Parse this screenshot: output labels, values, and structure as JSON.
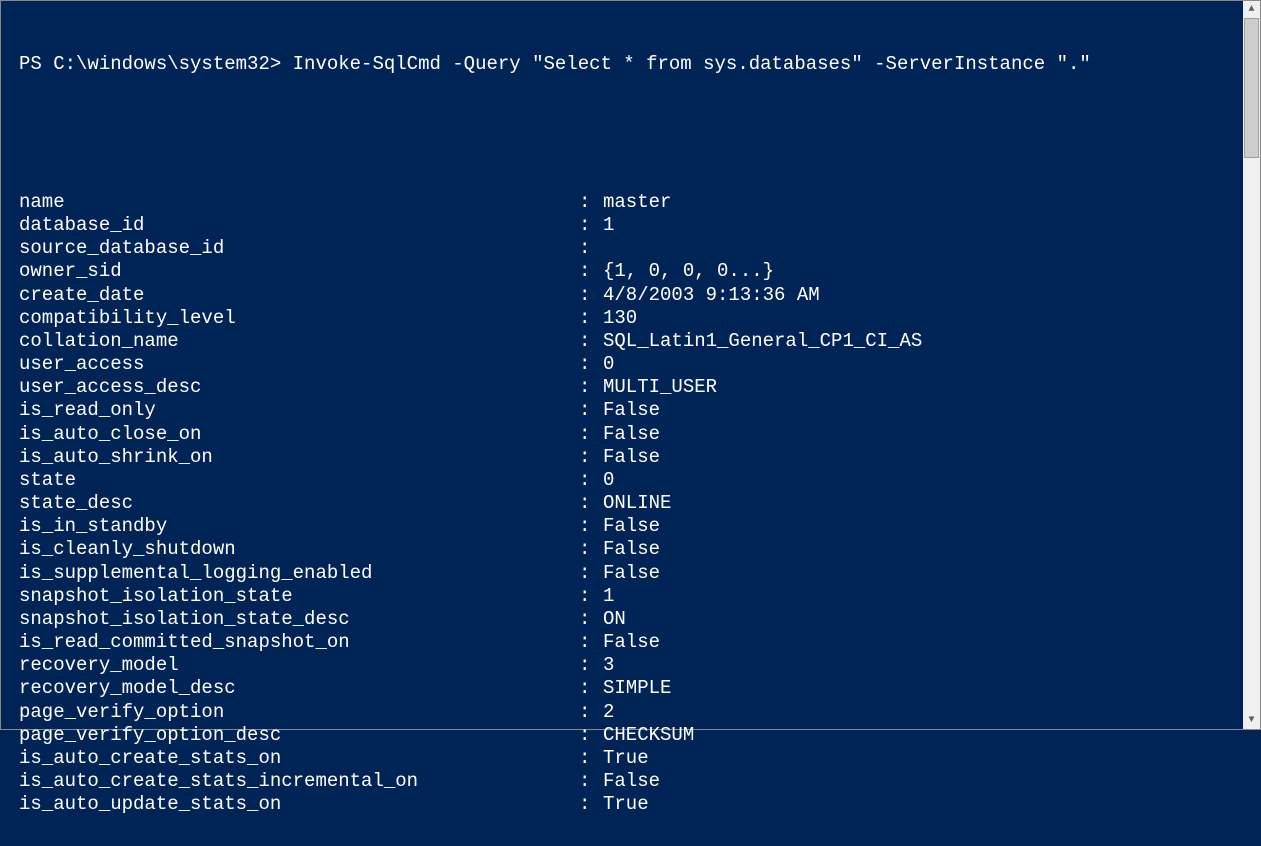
{
  "prompt": "PS C:\\windows\\system32> Invoke-SqlCmd -Query \"Select * from sys.databases\" -ServerInstance \".\"",
  "rows": [
    {
      "key": "name",
      "val": "master"
    },
    {
      "key": "database_id",
      "val": "1"
    },
    {
      "key": "source_database_id",
      "val": ""
    },
    {
      "key": "owner_sid",
      "val": "{1, 0, 0, 0...}"
    },
    {
      "key": "create_date",
      "val": "4/8/2003 9:13:36 AM"
    },
    {
      "key": "compatibility_level",
      "val": "130"
    },
    {
      "key": "collation_name",
      "val": "SQL_Latin1_General_CP1_CI_AS"
    },
    {
      "key": "user_access",
      "val": "0"
    },
    {
      "key": "user_access_desc",
      "val": "MULTI_USER"
    },
    {
      "key": "is_read_only",
      "val": "False"
    },
    {
      "key": "is_auto_close_on",
      "val": "False"
    },
    {
      "key": "is_auto_shrink_on",
      "val": "False"
    },
    {
      "key": "state",
      "val": "0"
    },
    {
      "key": "state_desc",
      "val": "ONLINE"
    },
    {
      "key": "is_in_standby",
      "val": "False"
    },
    {
      "key": "is_cleanly_shutdown",
      "val": "False"
    },
    {
      "key": "is_supplemental_logging_enabled",
      "val": "False"
    },
    {
      "key": "snapshot_isolation_state",
      "val": "1"
    },
    {
      "key": "snapshot_isolation_state_desc",
      "val": "ON"
    },
    {
      "key": "is_read_committed_snapshot_on",
      "val": "False"
    },
    {
      "key": "recovery_model",
      "val": "3"
    },
    {
      "key": "recovery_model_desc",
      "val": "SIMPLE"
    },
    {
      "key": "page_verify_option",
      "val": "2"
    },
    {
      "key": "page_verify_option_desc",
      "val": "CHECKSUM"
    },
    {
      "key": "is_auto_create_stats_on",
      "val": "True"
    },
    {
      "key": "is_auto_create_stats_incremental_on",
      "val": "False"
    },
    {
      "key": "is_auto_update_stats_on",
      "val": "True"
    }
  ],
  "separator": ":",
  "scrollbar": {
    "up": "▲",
    "down": "▼"
  }
}
